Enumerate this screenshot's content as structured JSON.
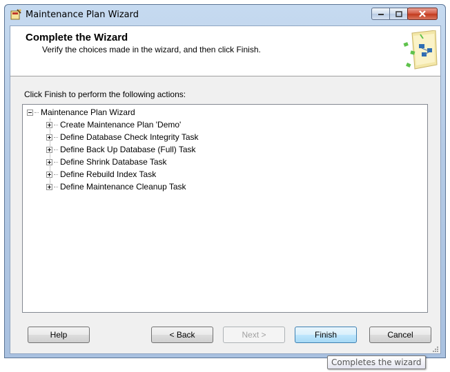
{
  "window": {
    "title": "Maintenance Plan Wizard",
    "icon": "wizard-app-icon"
  },
  "header": {
    "title": "Complete the Wizard",
    "subtitle": "Verify the choices made in the wizard, and then click Finish."
  },
  "instructions": "Click Finish to perform the following actions:",
  "tree": {
    "root": {
      "label": "Maintenance Plan Wizard",
      "expanded": true
    },
    "children": [
      {
        "label": "Create Maintenance Plan 'Demo'",
        "expanded": false
      },
      {
        "label": "Define Database Check Integrity Task",
        "expanded": false
      },
      {
        "label": "Define Back Up Database (Full) Task",
        "expanded": false
      },
      {
        "label": "Define Shrink Database Task",
        "expanded": false
      },
      {
        "label": "Define Rebuild Index Task",
        "expanded": false
      },
      {
        "label": "Define Maintenance Cleanup Task",
        "expanded": false
      }
    ]
  },
  "buttons": {
    "help": "Help",
    "back": "< Back",
    "next": "Next >",
    "finish": "Finish",
    "cancel": "Cancel"
  },
  "tooltip": "Completes the wizard",
  "colors": {
    "titlebar": "#b9cde6",
    "close": "#c94a2f",
    "finish_highlight": "#bee6fd"
  }
}
